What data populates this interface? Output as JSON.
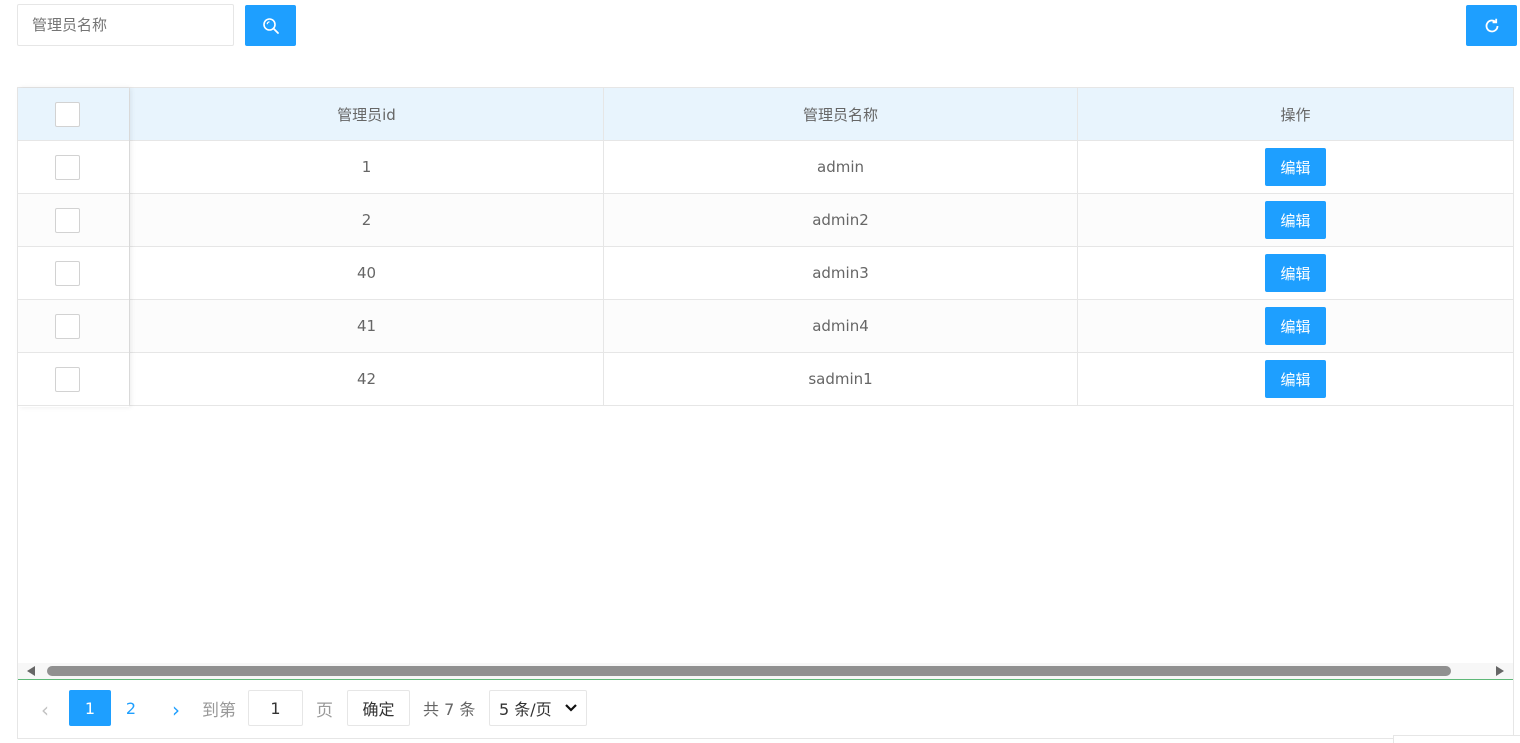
{
  "toolbar": {
    "search_placeholder": "管理员名称",
    "search_icon": "search-icon",
    "refresh_icon": "refresh-icon"
  },
  "table": {
    "columns": [
      "管理员id",
      "管理员名称",
      "操作"
    ],
    "rows": [
      {
        "id": "1",
        "name": "admin",
        "action": "编辑"
      },
      {
        "id": "2",
        "name": "admin2",
        "action": "编辑"
      },
      {
        "id": "40",
        "name": "admin3",
        "action": "编辑"
      },
      {
        "id": "41",
        "name": "admin4",
        "action": "编辑"
      },
      {
        "id": "42",
        "name": "sadmin1",
        "action": "编辑"
      }
    ]
  },
  "pager": {
    "prev": "‹",
    "pages": [
      "1",
      "2"
    ],
    "current_page": "1",
    "next": "›",
    "goto_label": "到第",
    "goto_value": "1",
    "page_unit": "页",
    "confirm_label": "确定",
    "total_text": "共 7 条",
    "page_size": "5 条/页"
  },
  "colors": {
    "accent": "#1e9fff",
    "header_bg": "#e8f4fd",
    "border": "#e6e6e6"
  }
}
